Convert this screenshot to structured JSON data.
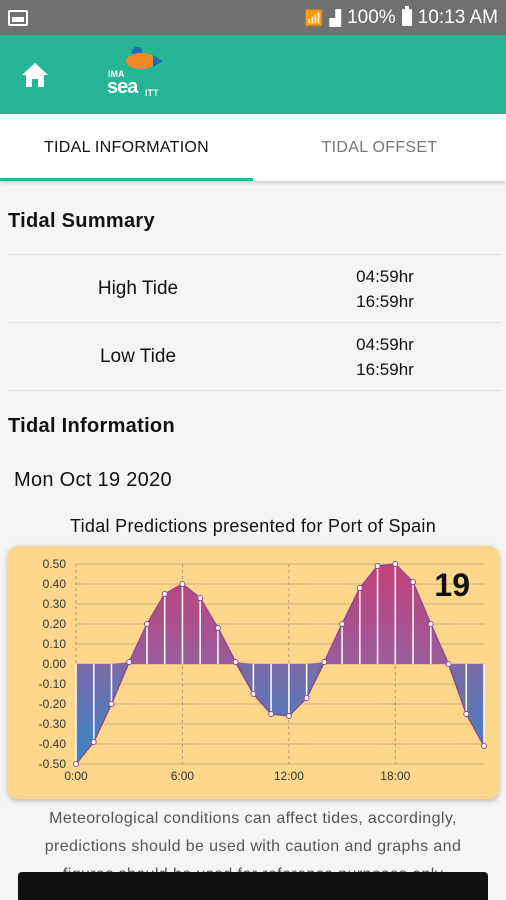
{
  "status_bar": {
    "battery": "100%",
    "time": "10:13 AM",
    "icons": [
      "gallery-icon",
      "wifi-icon",
      "signal-icon",
      "battery-icon"
    ]
  },
  "app_bar": {
    "color": "#26b597",
    "logo": {
      "top": "IMA",
      "main": "sea",
      "suffix": "ITT"
    }
  },
  "tabs": [
    {
      "label": "TIDAL INFORMATION",
      "active": true
    },
    {
      "label": "TIDAL OFFSET",
      "active": false
    }
  ],
  "summary": {
    "title": "Tidal Summary",
    "rows": [
      {
        "label": "High Tide",
        "time1": "04:59hr",
        "time2": "16:59hr"
      },
      {
        "label": "Low Tide",
        "time1": "04:59hr",
        "time2": "16:59hr"
      }
    ]
  },
  "information": {
    "title": "Tidal Information",
    "date": "Mon Oct 19 2020",
    "chart_title": "Tidal Predictions presented for Port of Spain",
    "note": "Meteorological conditions can affect tides, accordingly, predictions should be used with caution and graphs and figures should be used for reference purposes only"
  },
  "chart_data": {
    "type": "area",
    "day_label": "19",
    "xlabel": "",
    "ylabel": "",
    "x_ticks": [
      "0:00",
      "6:00",
      "12:00",
      "18:00"
    ],
    "xlim": [
      0,
      23
    ],
    "ylim": [
      -0.5,
      0.5
    ],
    "y_ticks": [
      "0.50",
      "0.40",
      "0.30",
      "0.20",
      "0.10",
      "0.00",
      "-0.10",
      "-0.20",
      "-0.30",
      "-0.40",
      "-0.50"
    ],
    "grid": true,
    "colors": {
      "positive": "#c2407a",
      "negative": "#3a86c8",
      "background": "#fdd88c"
    },
    "x": [
      0,
      1,
      2,
      3,
      4,
      5,
      6,
      7,
      8,
      9,
      10,
      11,
      12,
      13,
      14,
      15,
      16,
      17,
      18,
      19,
      20,
      21,
      22,
      23
    ],
    "values": [
      -0.5,
      -0.39,
      -0.2,
      0.01,
      0.2,
      0.35,
      0.4,
      0.33,
      0.18,
      0.01,
      -0.15,
      -0.25,
      -0.26,
      -0.17,
      0.01,
      0.2,
      0.38,
      0.49,
      0.5,
      0.41,
      0.2,
      0.0,
      -0.25,
      -0.41
    ]
  }
}
